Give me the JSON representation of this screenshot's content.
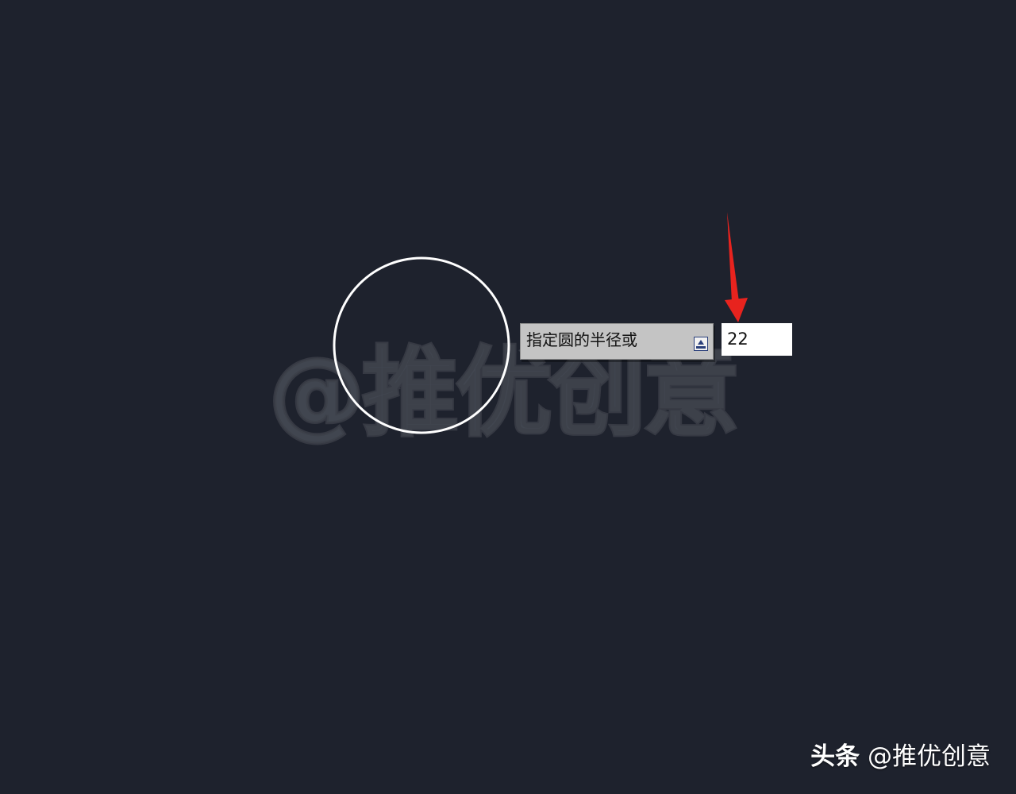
{
  "watermark": {
    "center_text": "@推优创意",
    "footer_brand": "头条",
    "footer_handle": "@推优创意"
  },
  "command_prompt": {
    "label": "指定圆的半径或",
    "dropdown_icon": "arrow-down-icon"
  },
  "radius_input": {
    "value": "22"
  },
  "colors": {
    "background": "#1e222d",
    "circle_stroke": "#ffffff",
    "annotation_arrow": "#e8231e",
    "prompt_background": "#c4c4c4"
  }
}
